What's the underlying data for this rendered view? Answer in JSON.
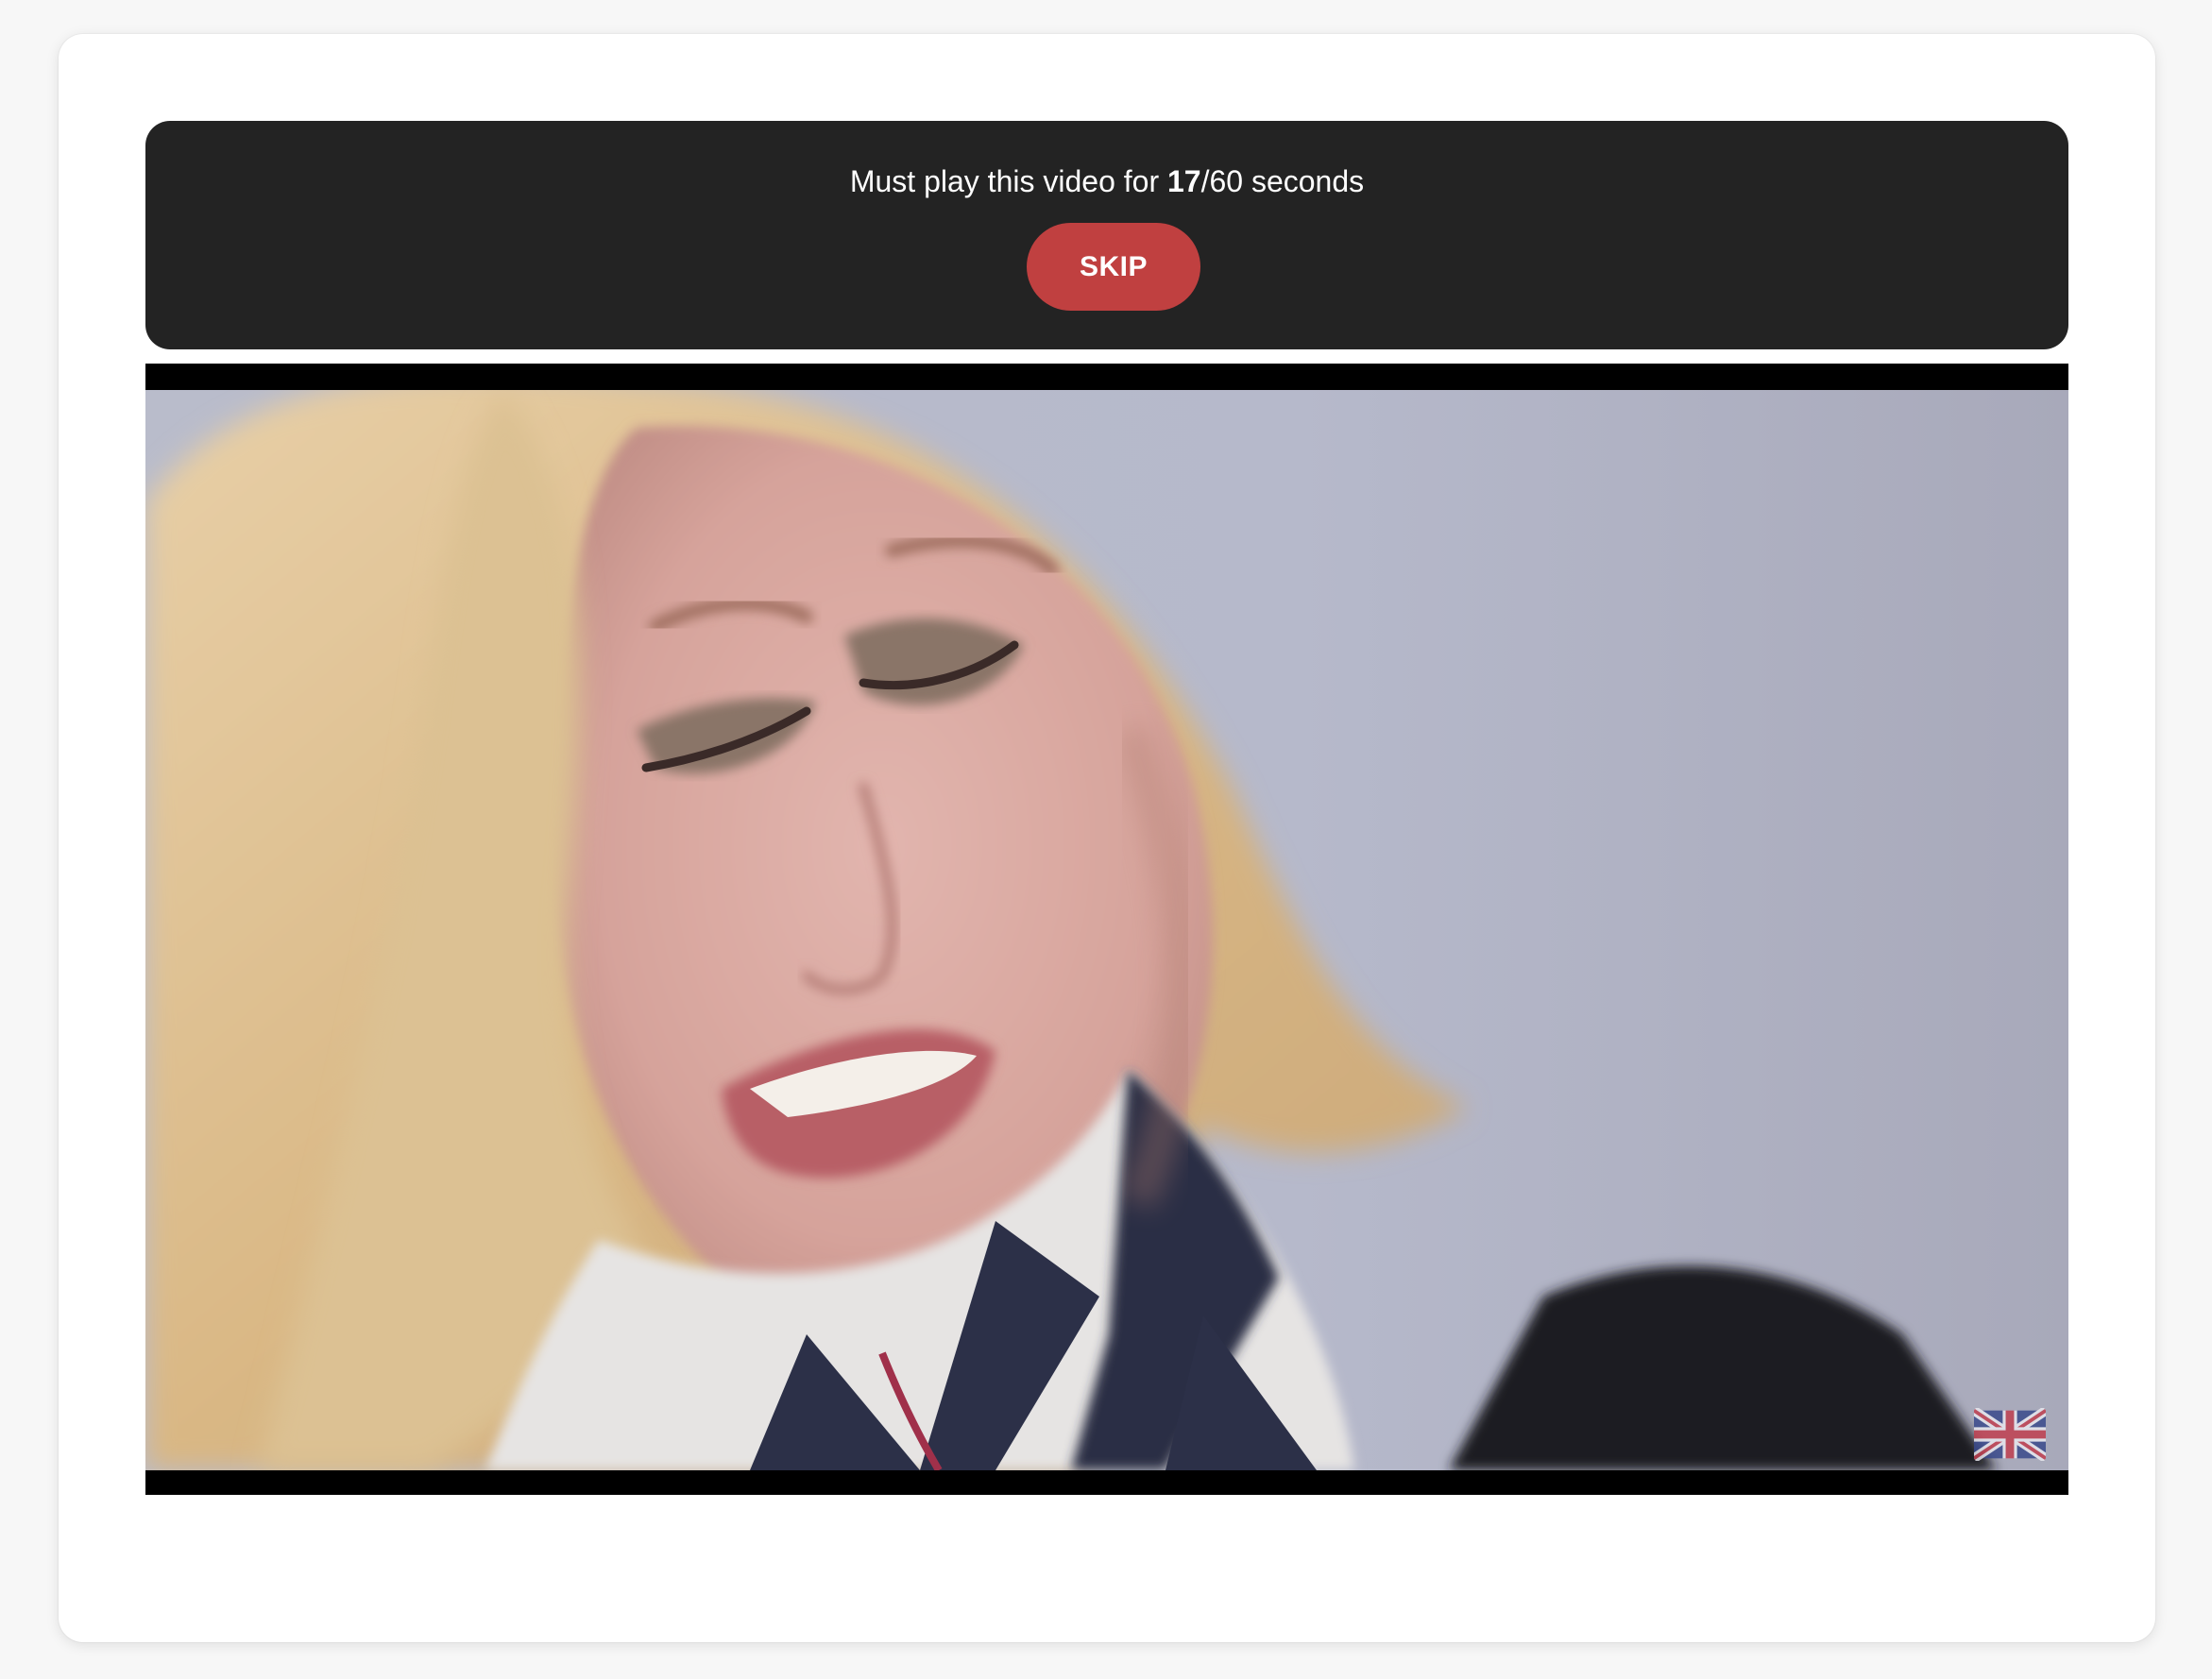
{
  "banner": {
    "prefix": "Must play this video for ",
    "elapsed": "17",
    "suffix": "/60 seconds",
    "skip_label": "SKIP",
    "colors": {
      "background": "#232323",
      "skip_button": "#c04040"
    }
  },
  "video": {
    "watermark_icon": "uk-flag-icon"
  }
}
